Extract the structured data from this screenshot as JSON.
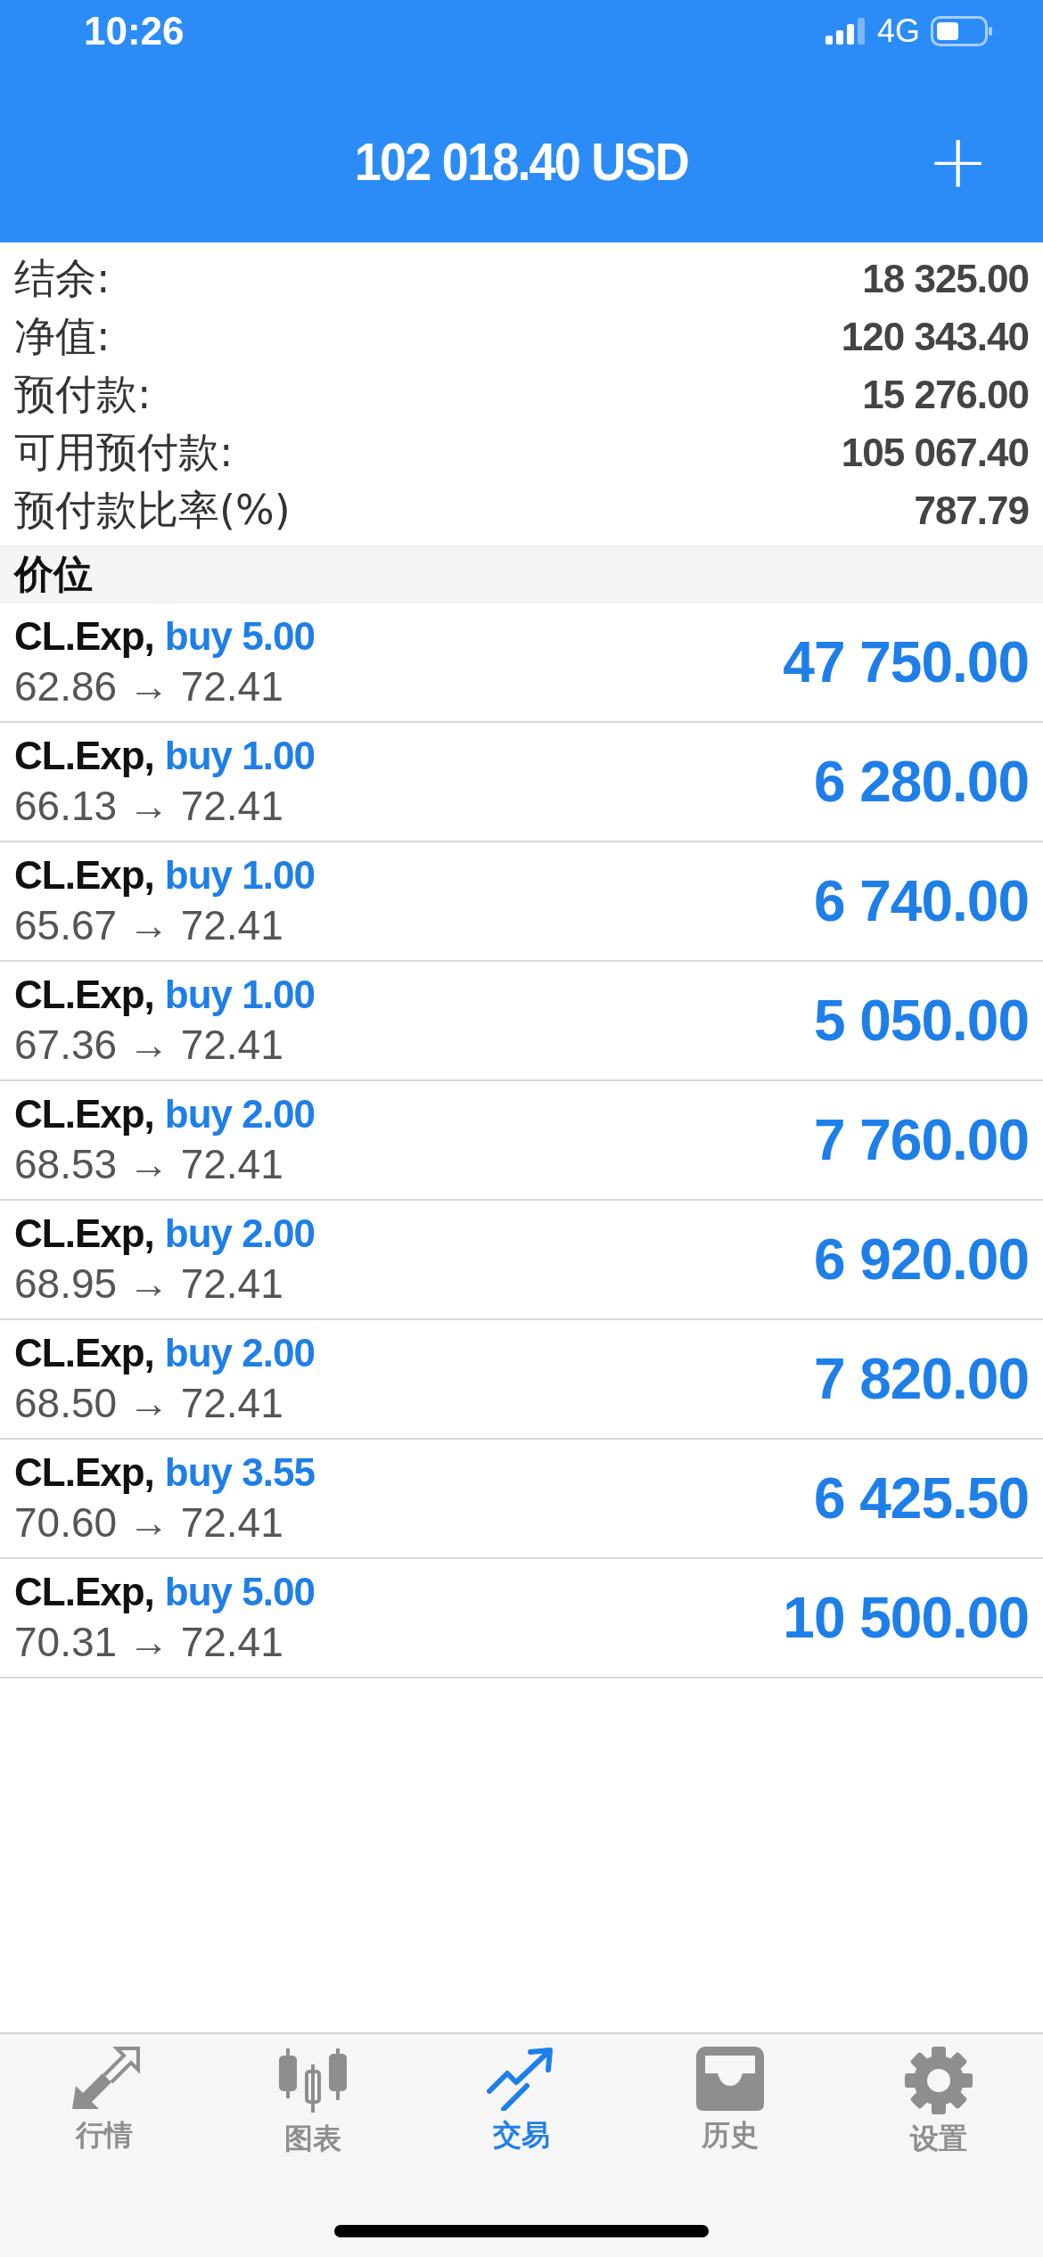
{
  "status_bar": {
    "time": "10:26",
    "network": "4G"
  },
  "header": {
    "title": "102 018.40 USD",
    "add_button": "+"
  },
  "summary": [
    {
      "label": "结余:",
      "value": "18 325.00"
    },
    {
      "label": "净值:",
      "value": "120 343.40"
    },
    {
      "label": "预付款:",
      "value": "15 276.00"
    },
    {
      "label": "可用预付款:",
      "value": "105 067.40"
    },
    {
      "label": "预付款比率(%)",
      "value": "787.79"
    }
  ],
  "section_title": "价位",
  "positions": [
    {
      "symbol": "CL.Exp,",
      "order": "buy 5.00",
      "prices": "62.86 → 72.41",
      "profit": "47 750.00"
    },
    {
      "symbol": "CL.Exp,",
      "order": "buy 1.00",
      "prices": "66.13 → 72.41",
      "profit": "6 280.00"
    },
    {
      "symbol": "CL.Exp,",
      "order": "buy 1.00",
      "prices": "65.67 → 72.41",
      "profit": "6 740.00"
    },
    {
      "symbol": "CL.Exp,",
      "order": "buy 1.00",
      "prices": "67.36 → 72.41",
      "profit": "5 050.00"
    },
    {
      "symbol": "CL.Exp,",
      "order": "buy 2.00",
      "prices": "68.53 → 72.41",
      "profit": "7 760.00"
    },
    {
      "symbol": "CL.Exp,",
      "order": "buy 2.00",
      "prices": "68.95 → 72.41",
      "profit": "6 920.00"
    },
    {
      "symbol": "CL.Exp,",
      "order": "buy 2.00",
      "prices": "68.50 → 72.41",
      "profit": "7 820.00"
    },
    {
      "symbol": "CL.Exp,",
      "order": "buy 3.55",
      "prices": "70.60 → 72.41",
      "profit": "6 425.50"
    },
    {
      "symbol": "CL.Exp,",
      "order": "buy 5.00",
      "prices": "70.31 → 72.41",
      "profit": "10 500.00"
    }
  ],
  "tabs": [
    {
      "kind": "quotes",
      "label": "行情",
      "selected": false
    },
    {
      "kind": "chart",
      "label": "图表",
      "selected": false
    },
    {
      "kind": "trade",
      "label": "交易",
      "selected": true
    },
    {
      "kind": "history",
      "label": "历史",
      "selected": false
    },
    {
      "kind": "settings",
      "label": "设置",
      "selected": false
    }
  ]
}
